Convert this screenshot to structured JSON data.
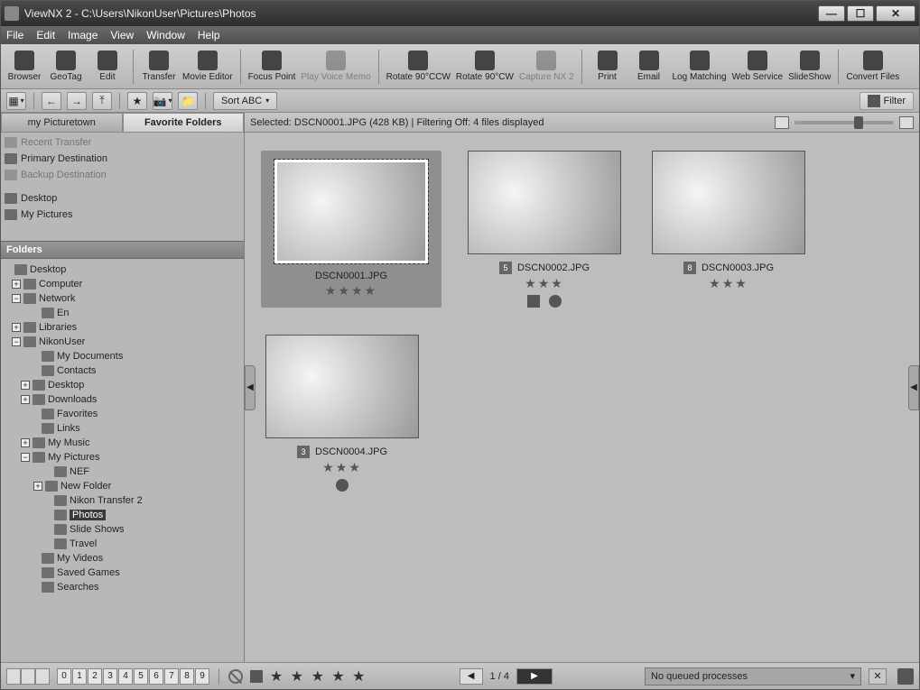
{
  "window": {
    "title": "ViewNX 2 - C:\\Users\\NikonUser\\Pictures\\Photos"
  },
  "menu": {
    "file": "File",
    "edit": "Edit",
    "image": "Image",
    "view": "View",
    "window": "Window",
    "help": "Help"
  },
  "toolbar": {
    "browser": "Browser",
    "geotag": "GeoTag",
    "edit": "Edit",
    "transfer": "Transfer",
    "movie": "Movie Editor",
    "focus": "Focus Point",
    "voice": "Play Voice Memo",
    "rotccw": "Rotate 90°CCW",
    "rotcw": "Rotate 90°CW",
    "nx2": "Capture NX 2",
    "print": "Print",
    "email": "Email",
    "log": "Log Matching",
    "web": "Web Service",
    "slide": "SlideShow",
    "convert": "Convert Files"
  },
  "toolbar2": {
    "sort": "Sort ABC",
    "filter": "Filter"
  },
  "sidebar": {
    "tabs": {
      "pt": "my Picturetown",
      "fav": "Favorite Folders"
    },
    "fav": {
      "recent": "Recent Transfer",
      "primary": "Primary Destination",
      "backup": "Backup Destination",
      "desktop": "Desktop",
      "mypics": "My Pictures"
    },
    "folders_hdr": "Folders",
    "tree": {
      "desktop": "Desktop",
      "computer": "Computer",
      "network": "Network",
      "en": "En",
      "libraries": "Libraries",
      "nikonuser": "NikonUser",
      "mydocs": "My Documents",
      "contacts": "Contacts",
      "desk2": "Desktop",
      "downloads": "Downloads",
      "favorites": "Favorites",
      "links": "Links",
      "music": "My Music",
      "mypics": "My Pictures",
      "nef": "NEF",
      "newfolder": "New Folder",
      "ntransfer": "Nikon Transfer 2",
      "photos": "Photos",
      "slideshows": "Slide Shows",
      "travel": "Travel",
      "videos": "My Videos",
      "saved": "Saved Games",
      "searches": "Searches"
    }
  },
  "status": {
    "text": "Selected: DSCN0001.JPG (428 KB) | Filtering Off: 4 files displayed"
  },
  "thumbs": [
    {
      "file": "DSCN0001.JPG",
      "stars": "★★★★",
      "selected": true
    },
    {
      "file": "DSCN0002.JPG",
      "stars": "★★★",
      "badge": "5",
      "info": true,
      "geo": true
    },
    {
      "file": "DSCN0003.JPG",
      "stars": "★★★",
      "badge": "8"
    },
    {
      "file": "DSCN0004.JPG",
      "stars": "★★★",
      "badge": "3",
      "geo": true
    }
  ],
  "bottom": {
    "numbers": [
      "0",
      "1",
      "2",
      "3",
      "4",
      "5",
      "6",
      "7",
      "8",
      "9"
    ],
    "stars": "★ ★ ★ ★ ★",
    "page": "1 / 4",
    "queue": "No queued processes"
  }
}
